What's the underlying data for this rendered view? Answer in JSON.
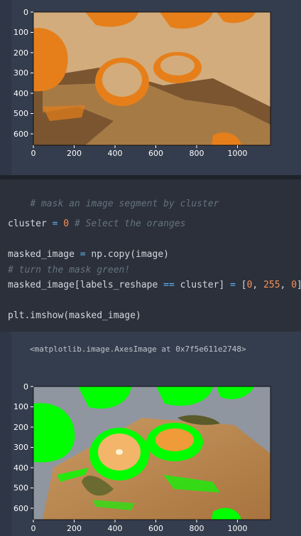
{
  "output1": {
    "plot": {
      "y_ticks": [
        "0",
        "100",
        "200",
        "300",
        "400",
        "500",
        "600"
      ],
      "x_ticks": [
        "0",
        "200",
        "400",
        "600",
        "800",
        "1000"
      ]
    }
  },
  "code_cell": {
    "line1": "# mask an image segment by cluster",
    "line2_var": "cluster",
    "line2_op": "=",
    "line2_num": "0",
    "line2_comment": "# Select the oranges",
    "line3_lhs": "masked_image",
    "line3_op": "=",
    "line3_rhs": "np.copy(image)",
    "line4_comment": "# turn the mask green!",
    "line5_a": "masked_image[labels_reshape",
    "line5_eq": "==",
    "line5_b": "cluster]",
    "line5_op": "=",
    "line5_open": "[",
    "line5_n1": "0",
    "line5_c1": ",",
    "line5_n2": "255",
    "line5_c2": ",",
    "line5_n3": "0",
    "line5_close": "]",
    "line6": "plt.imshow(masked_image)"
  },
  "output2": {
    "repr_text": "<matplotlib.image.AxesImage at 0x7f5e611e2748>",
    "plot": {
      "y_ticks": [
        "0",
        "100",
        "200",
        "300",
        "400",
        "500",
        "600"
      ],
      "x_ticks": [
        "0",
        "200",
        "400",
        "600",
        "800",
        "1000"
      ]
    }
  },
  "colors": {
    "segmented_tan": "#d2ac7c",
    "segmented_orange": "#e67f1a",
    "segmented_brown": "#7a5530",
    "mask_green": "#00ff00",
    "wood": "#c48a50",
    "orange_flesh": "#e89a3a",
    "backdrop": "#9aa0a8"
  }
}
